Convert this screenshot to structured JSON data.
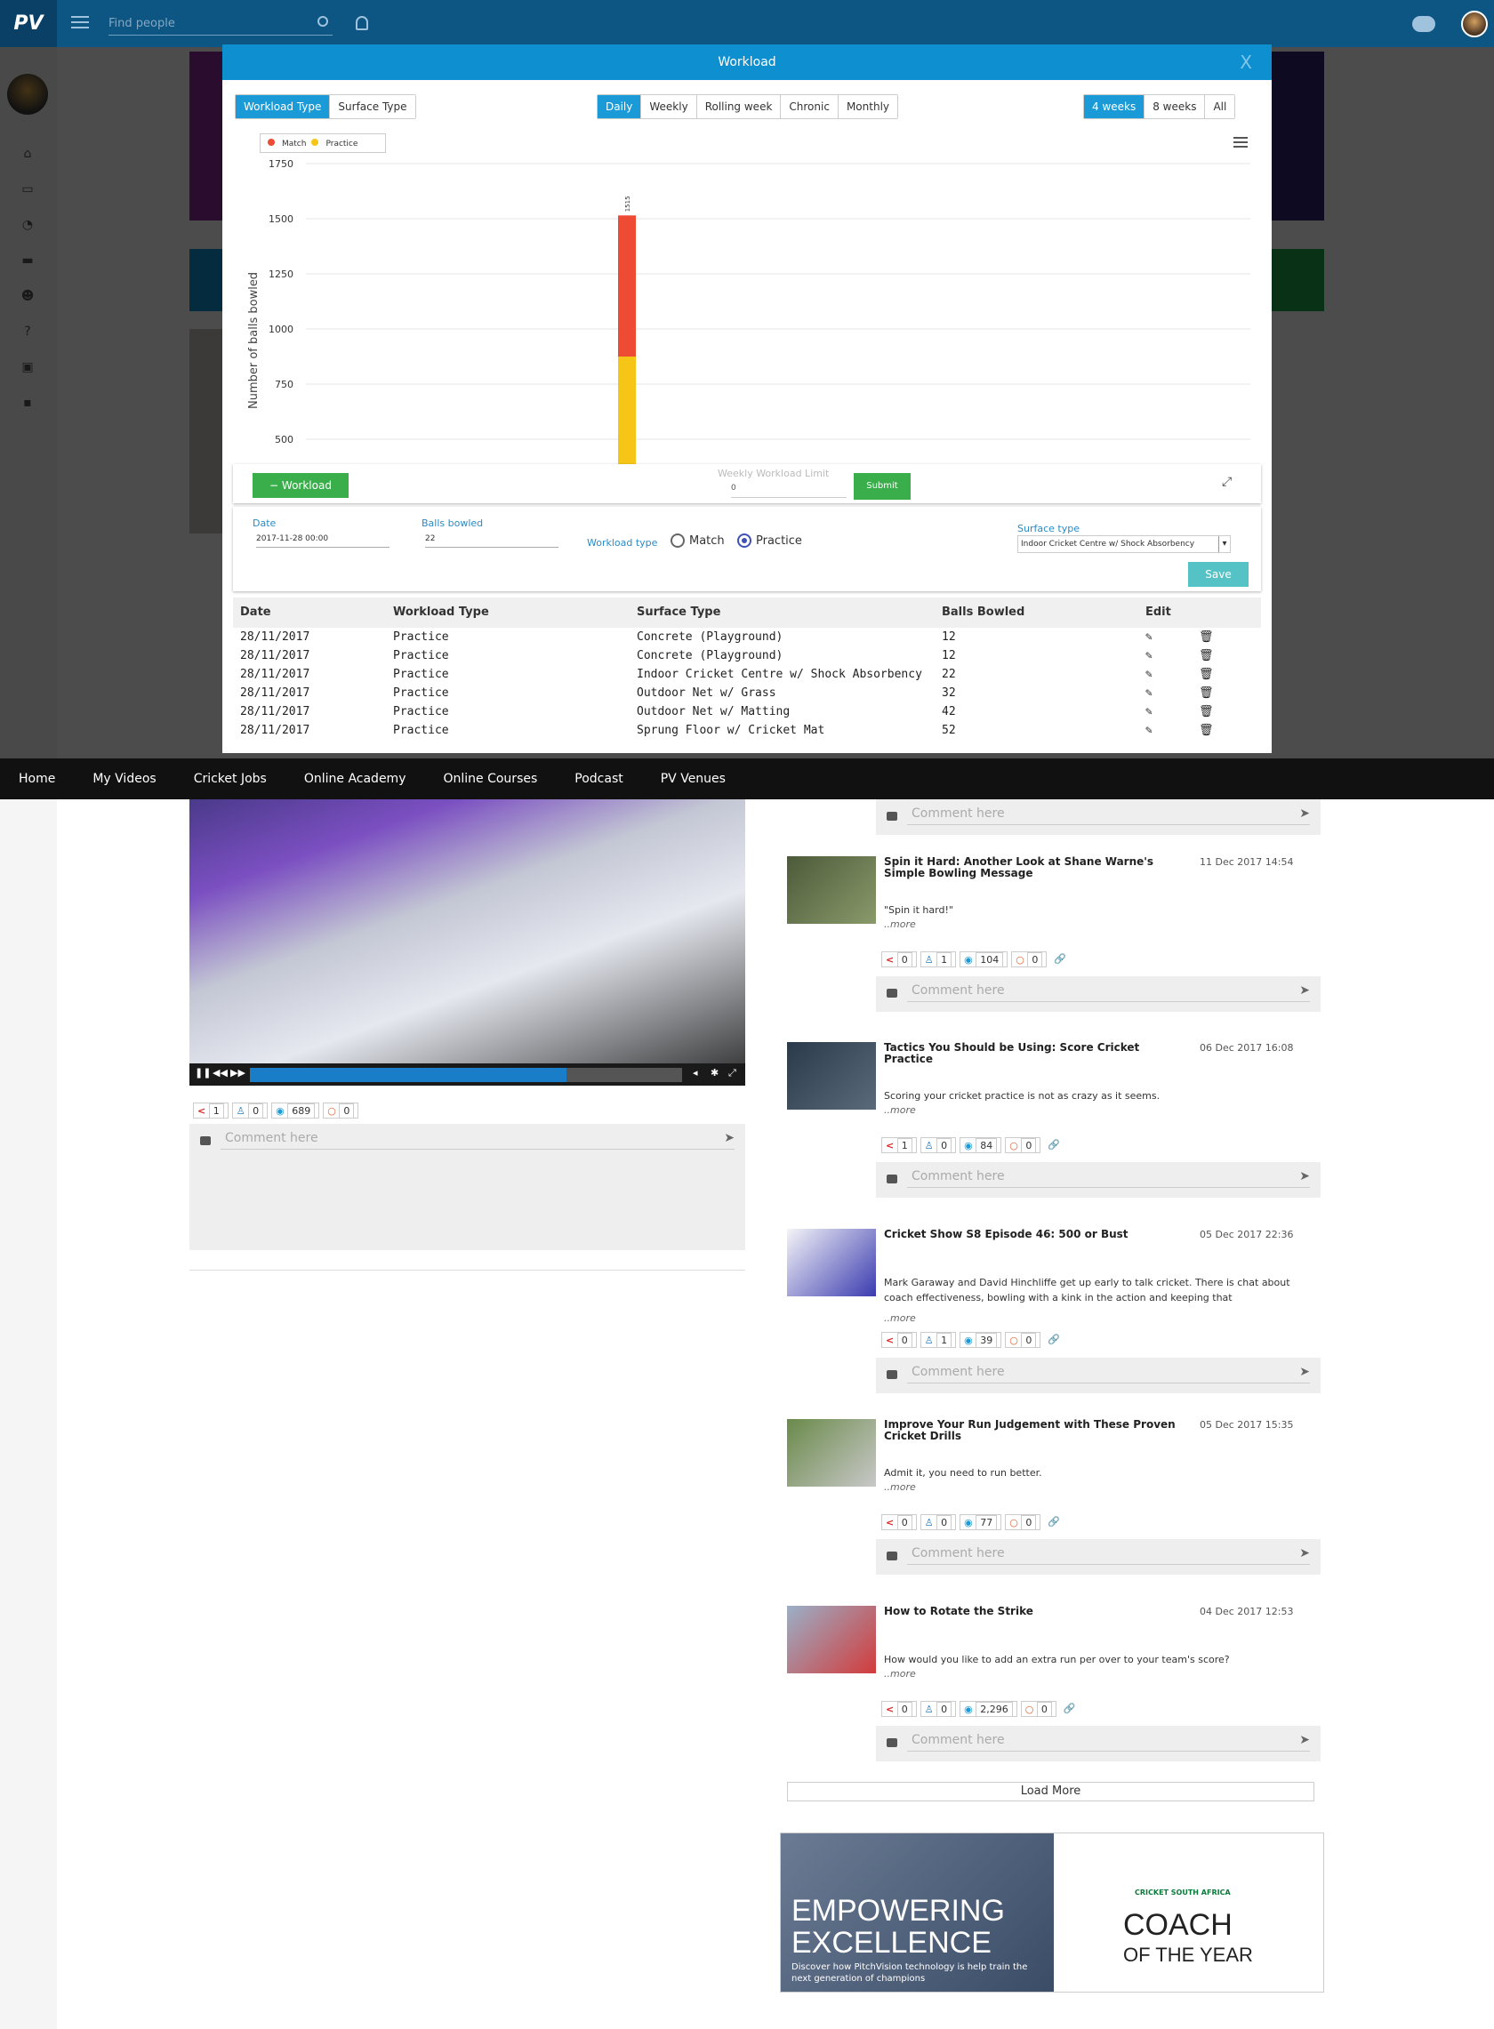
{
  "topbar": {
    "search_placeholder": "Find people"
  },
  "modal": {
    "title": "Workload",
    "close": "X",
    "type_tabs": [
      "Workload Type",
      "Surface Type"
    ],
    "period_tabs": [
      "Daily",
      "Weekly",
      "Rolling week",
      "Chronic",
      "Monthly"
    ],
    "range_tabs": [
      "4 weeks",
      "8 weeks",
      "All"
    ],
    "active": {
      "type": "Workload Type",
      "period": "Daily",
      "range": "4 weeks"
    }
  },
  "chart_data": {
    "type": "bar",
    "stacked": true,
    "ylabel": "Number of balls bowled",
    "yticks": [
      500,
      750,
      1000,
      1250,
      1500,
      1750
    ],
    "ylim": [
      480,
      1750
    ],
    "legend_position": "top-left",
    "series": [
      {
        "name": "Match",
        "color": "#ee4b34",
        "values": [
          640
        ]
      },
      {
        "name": "Practice",
        "color": "#f5c518",
        "values": [
          875
        ]
      }
    ],
    "total_label": "1515"
  },
  "workload_bar": {
    "button": "Workload",
    "limit_label": "Weekly Workload Limit",
    "limit_value": "0",
    "submit": "Submit"
  },
  "form": {
    "date_label": "Date",
    "date_value": "2017-11-28 00:00",
    "balls_label": "Balls bowled",
    "balls_value": "22",
    "type_label": "Workload type",
    "type_options": [
      "Match",
      "Practice"
    ],
    "type_selected": "Practice",
    "surface_label": "Surface type",
    "surface_value": "Indoor Cricket Centre w/ Shock Absorbency",
    "save": "Save"
  },
  "table": {
    "headers": [
      "Date",
      "Workload Type",
      "Surface Type",
      "Balls Bowled",
      "Edit"
    ],
    "rows": [
      [
        "28/11/2017",
        "Practice",
        "Concrete (Playground)",
        "12"
      ],
      [
        "28/11/2017",
        "Practice",
        "Concrete (Playground)",
        "12"
      ],
      [
        "28/11/2017",
        "Practice",
        "Indoor Cricket Centre w/ Shock Absorbency",
        "22"
      ],
      [
        "28/11/2017",
        "Practice",
        "Outdoor Net w/ Grass",
        "32"
      ],
      [
        "28/11/2017",
        "Practice",
        "Outdoor Net w/ Matting",
        "42"
      ],
      [
        "28/11/2017",
        "Practice",
        "Sprung Floor w/ Cricket Mat",
        "52"
      ]
    ]
  },
  "nav": [
    "Home",
    "My Videos",
    "Cricket Jobs",
    "Online Academy",
    "Online Courses",
    "Podcast",
    "PV Venues"
  ],
  "video": {
    "stats": [
      "1",
      "0",
      "689",
      "0"
    ],
    "comment_placeholder": "Comment here"
  },
  "feed": [
    {
      "title": "Spin it Hard: Another Look at Shane Warne's Simple Bowling Message",
      "date": "11 Dec 2017 14:54",
      "desc": "\"Spin it hard!\"",
      "more": "..more",
      "stats": [
        "0",
        "1",
        "104",
        "0"
      ],
      "comment": "Comment here"
    },
    {
      "title": "Tactics You Should be Using: Score Cricket Practice",
      "date": "06 Dec 2017 16:08",
      "desc": "Scoring your cricket practice is not as crazy as it seems.",
      "more": "..more",
      "stats": [
        "1",
        "0",
        "84",
        "0"
      ],
      "comment": "Comment here"
    },
    {
      "title": "Cricket Show S8 Episode 46: 500 or Bust",
      "date": "05 Dec 2017 22:36",
      "desc": "Mark Garaway and David Hinchliffe get up early to talk cricket. There is chat about coach effectiveness, bowling with a kink in the action and keeping that",
      "more": "..more",
      "stats": [
        "0",
        "1",
        "39",
        "0"
      ],
      "comment": "Comment here"
    },
    {
      "title": "Improve Your Run Judgement with These Proven Cricket Drills",
      "date": "05 Dec 2017 15:35",
      "desc": "Admit it, you need to run better.",
      "more": "..more",
      "stats": [
        "0",
        "0",
        "77",
        "0"
      ],
      "comment": "Comment here"
    },
    {
      "title": "How to Rotate the Strike",
      "date": "04 Dec 2017 12:53",
      "desc": "How would you like to add an extra run per over to your team's score?",
      "more": "..more",
      "stats": [
        "0",
        "0",
        "2,296",
        "0"
      ],
      "comment": "Comment here"
    }
  ],
  "feed_top_comment": "Comment here",
  "load_more": "Load More",
  "ad": {
    "line1": "EMPOWERING",
    "line2": "EXCELLENCE",
    "line3": "Discover how PitchVision technology is help train the next generation of champions",
    "badge": "CRICKET SOUTH AFRICA",
    "coach1": "COACH",
    "coach2": "OF THE YEAR"
  }
}
